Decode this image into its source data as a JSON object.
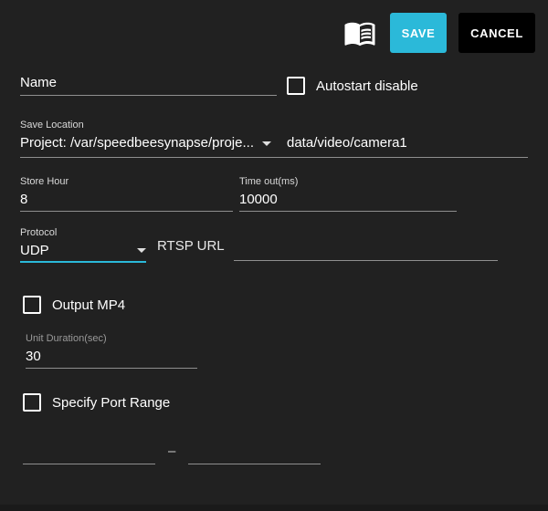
{
  "colors": {
    "background": "#212121",
    "accent": "#2bb9d9",
    "cancel_button": "#000000",
    "underline": "#8f8f8f"
  },
  "header": {
    "book_icon": "open-book-manual-icon",
    "save": "SAVE",
    "cancel": "CANCEL"
  },
  "fields": {
    "name": {
      "label": "Name",
      "value": ""
    },
    "autostart_disable": {
      "label": "Autostart disable",
      "checked": false
    },
    "save_location": {
      "label": "Save Location",
      "selected": "Project: /var/speedbeesynapse/proje...",
      "path": "data/video/camera1"
    },
    "store_hour": {
      "label": "Store Hour",
      "value": "8"
    },
    "time_out": {
      "label": "Time out(ms)",
      "value": "10000"
    },
    "protocol": {
      "label": "Protocol",
      "value": "UDP"
    },
    "rtsp_url": {
      "label": "RTSP URL",
      "value": ""
    },
    "output_mp4": {
      "label": "Output MP4",
      "checked": false
    },
    "unit_duration": {
      "label": "Unit Duration(sec)",
      "value": "30"
    },
    "specify_port_range": {
      "label": "Specify Port Range",
      "checked": false
    },
    "port_range": {
      "separator": "–",
      "min": "",
      "max": ""
    }
  }
}
